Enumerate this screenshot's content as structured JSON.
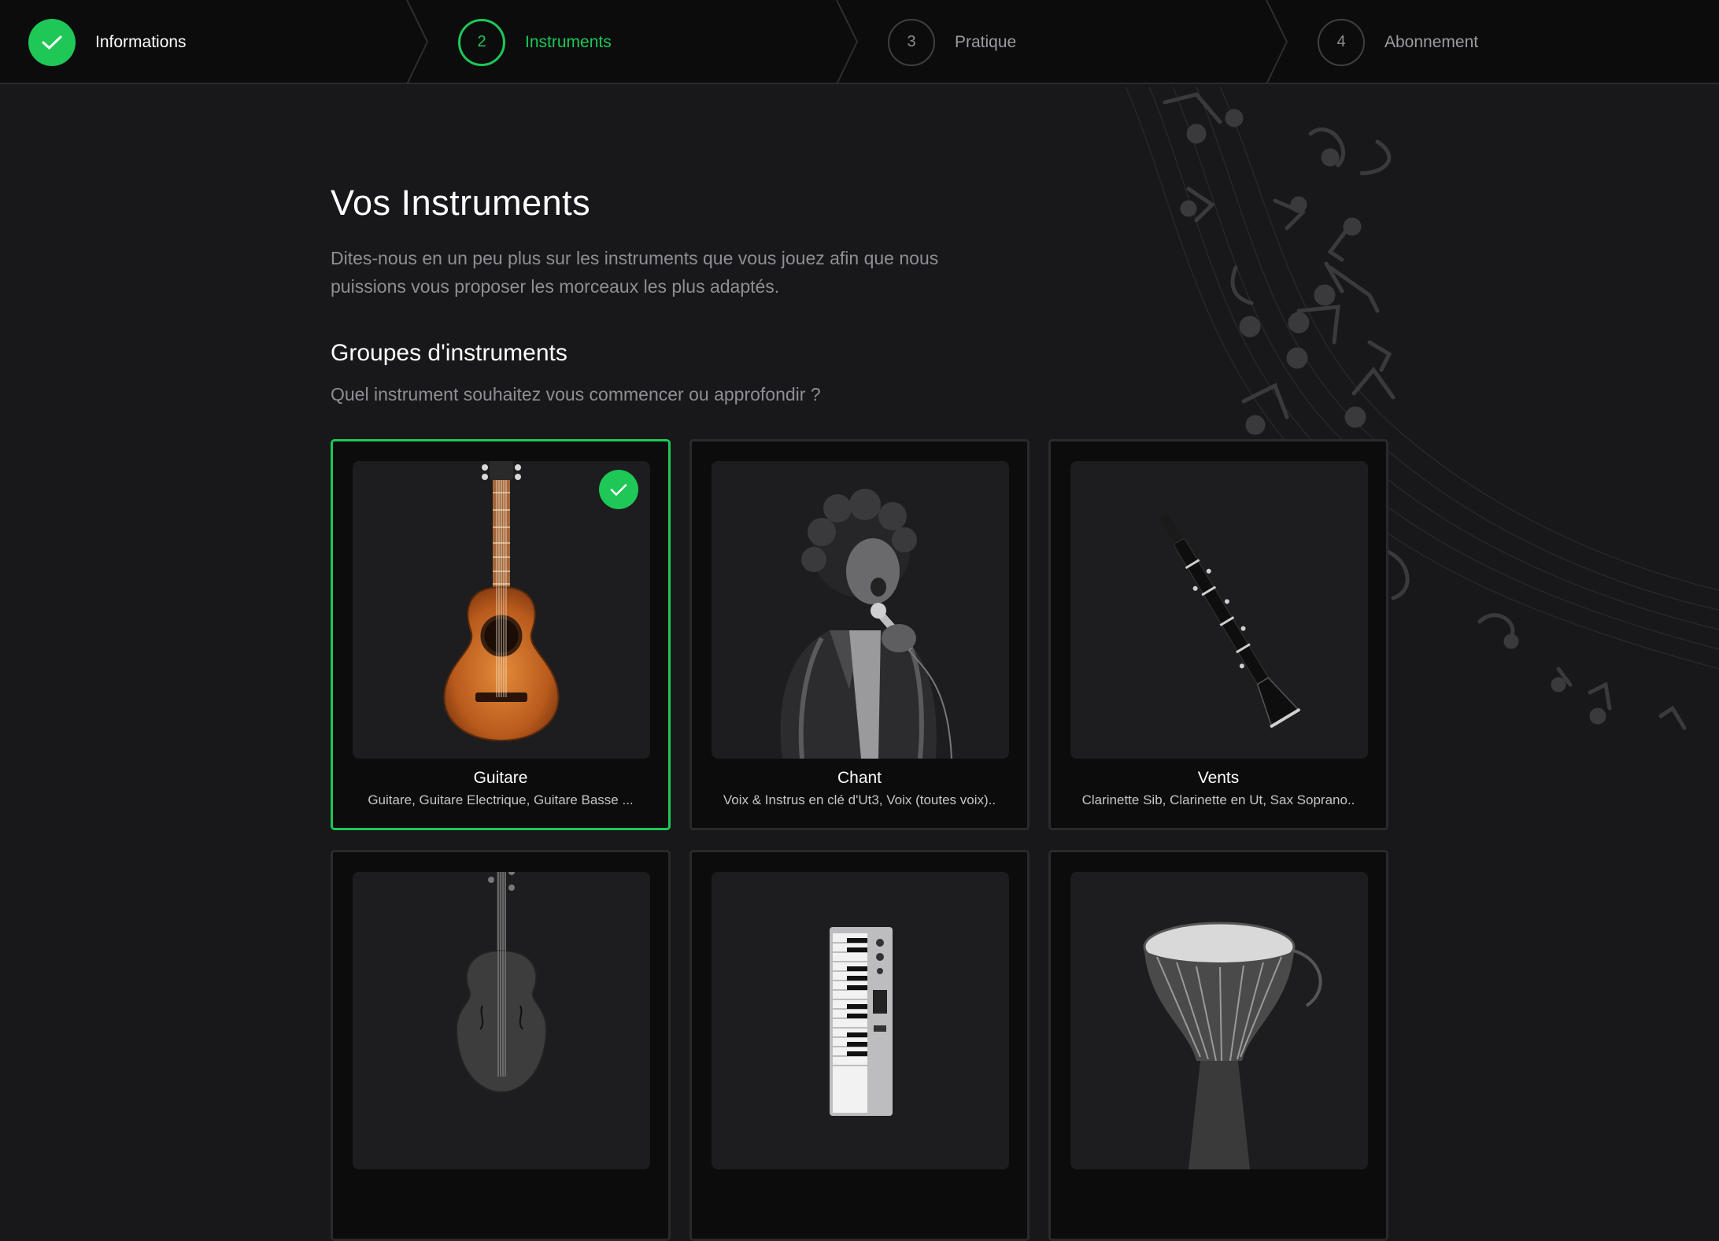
{
  "stepper": {
    "steps": [
      {
        "number": "",
        "label": "Informations",
        "state": "done"
      },
      {
        "number": "2",
        "label": "Instruments",
        "state": "active"
      },
      {
        "number": "3",
        "label": "Pratique",
        "state": "todo"
      },
      {
        "number": "4",
        "label": "Abonnement",
        "state": "todo"
      }
    ]
  },
  "main": {
    "title": "Vos Instruments",
    "intro": "Dites-nous en un peu plus sur les instruments que vous jouez afin que nous puissions vous proposer les morceaux les plus adaptés.",
    "section_title": "Groupes d'instruments",
    "section_question": "Quel instrument souhaitez vous commencer ou approfondir ?"
  },
  "instrument_groups": [
    {
      "title": "Guitare",
      "subtitle": "Guitare, Guitare Electrique, Guitare Basse ...",
      "selected": true,
      "icon": "guitar-image"
    },
    {
      "title": "Chant",
      "subtitle": "Voix & Instrus en clé d'Ut3, Voix (toutes voix)..",
      "selected": false,
      "icon": "singer-image"
    },
    {
      "title": "Vents",
      "subtitle": "Clarinette Sib, Clarinette en Ut, Sax Soprano..",
      "selected": false,
      "icon": "clarinet-image"
    },
    {
      "title": "",
      "subtitle": "",
      "selected": false,
      "icon": "cello-image"
    },
    {
      "title": "",
      "subtitle": "",
      "selected": false,
      "icon": "keyboard-image"
    },
    {
      "title": "",
      "subtitle": "",
      "selected": false,
      "icon": "djembe-image"
    }
  ],
  "colors": {
    "accent": "#1ec756",
    "background": "#18181a",
    "topbar": "#0c0c0d",
    "card": "#0c0c0d",
    "card_image_bg": "#1d1d1f",
    "muted_text": "#8e8e94"
  }
}
